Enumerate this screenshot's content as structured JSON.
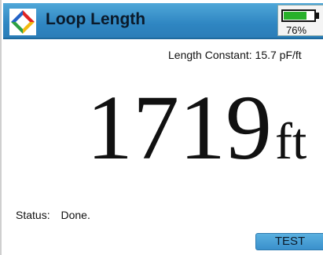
{
  "header": {
    "title": "Loop Length",
    "battery_percent_label": "76%",
    "battery_level": 0.76
  },
  "main": {
    "length_constant_label": "Length Constant:",
    "length_constant_value": "15.7 pF/ft",
    "reading_value": "1719",
    "reading_unit": "ft",
    "status_label": "Status:",
    "status_value": "Done."
  },
  "softkeys": {
    "test_label": "TEST"
  },
  "colors": {
    "title_bar": "#2f86c2",
    "softkey": "#3a90cc",
    "battery_fill": "#27b02a",
    "logo_red": "#e02424",
    "logo_yellow": "#f2b90f",
    "logo_green": "#2ea043",
    "logo_blue": "#2463c6"
  },
  "icons": {
    "logo": "diamond-logo-icon",
    "battery": "battery-icon"
  }
}
